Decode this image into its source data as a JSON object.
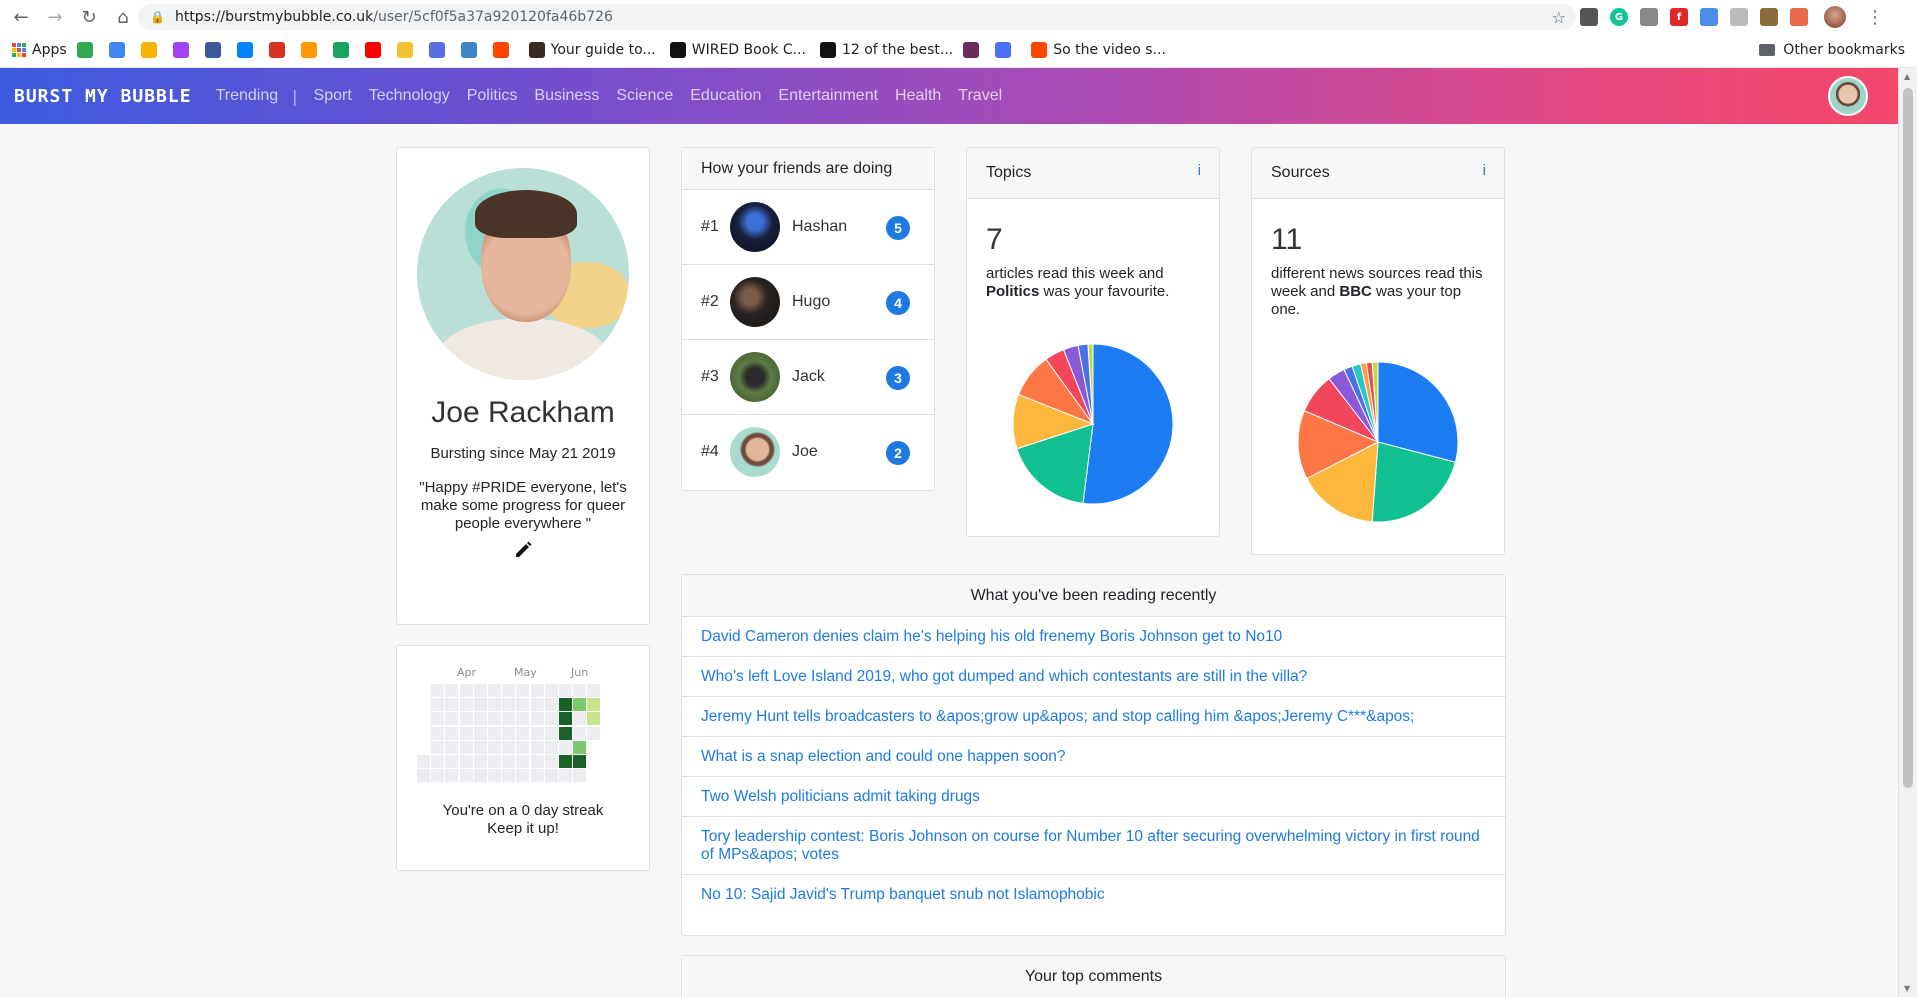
{
  "browser": {
    "url_host": "https://burstmybubble.co.uk",
    "url_path": "/user/5cf0f5a37a920120fa46b726",
    "bookmarks": [
      {
        "label": "Apps",
        "color": "#e8453c"
      },
      {
        "label": "",
        "color": "#34a853"
      },
      {
        "label": "",
        "color": "#4285f4"
      },
      {
        "label": "",
        "color": "#f4b400"
      },
      {
        "label": "",
        "color": "#a142f4"
      },
      {
        "label": "",
        "color": "#3b5998"
      },
      {
        "label": "",
        "color": "#0084ff"
      },
      {
        "label": "",
        "color": "#d93025"
      },
      {
        "label": "",
        "color": "#ff9900"
      },
      {
        "label": "",
        "color": "#1aa260"
      },
      {
        "label": "",
        "color": "#ff0000"
      },
      {
        "label": "",
        "color": "#f1c232"
      },
      {
        "label": "",
        "color": "#5b6ee1"
      },
      {
        "label": "",
        "color": "#3d85c6"
      },
      {
        "label": "",
        "color": "#ff4500"
      },
      {
        "label": "Your guide to...",
        "color": "#3a2a1f"
      },
      {
        "label": "WIRED Book C...",
        "color": "#111111"
      },
      {
        "label": "12 of the best...",
        "color": "#111111"
      },
      {
        "label": "",
        "color": "#6b2c5d"
      },
      {
        "label": "",
        "color": "#4f6df5"
      },
      {
        "label": "So the video s...",
        "color": "#ff4500"
      }
    ],
    "other_bookmarks": "Other bookmarks"
  },
  "navbar": {
    "brand": "BURST MY BUBBLE",
    "links": [
      "Trending",
      "Sport",
      "Technology",
      "Politics",
      "Business",
      "Science",
      "Education",
      "Entertainment",
      "Health",
      "Travel"
    ]
  },
  "profile": {
    "name": "Joe Rackham",
    "since": "Bursting since May 21 2019",
    "bio": "\"Happy #PRIDE everyone, let's make some progress for queer people everywhere \""
  },
  "calendar": {
    "months": [
      "Apr",
      "May",
      "Jun"
    ],
    "streak_line1": "You're on a 0 day streak",
    "streak_line2": "Keep it up!",
    "colors": {
      "empty": "#ebedf0",
      "l1": "#c6e48b",
      "l2": "#7bc96f",
      "l3": "#239a3b",
      "l4": "#196127"
    }
  },
  "friends": {
    "title": "How your friends are doing",
    "items": [
      {
        "rank": "#1",
        "name": "Hashan",
        "score": "5"
      },
      {
        "rank": "#2",
        "name": "Hugo",
        "score": "4"
      },
      {
        "rank": "#3",
        "name": "Jack",
        "score": "3"
      },
      {
        "rank": "#4",
        "name": "Joe",
        "score": "2"
      }
    ]
  },
  "topics": {
    "title": "Topics",
    "info": "i",
    "count": "7",
    "text_before": "articles read this week and ",
    "favourite": "Politics",
    "text_after": " was your favourite."
  },
  "sources": {
    "title": "Sources",
    "info": "i",
    "count": "11",
    "text_before": "different news sources read this week and ",
    "favourite": "BBC",
    "text_after": " was your top one."
  },
  "reading": {
    "title": "What you've been reading recently",
    "articles": [
      "David Cameron denies claim he’s helping his old frenemy Boris Johnson get to No10",
      "Who’s left Love Island 2019, who got dumped and which contestants are still in the villa?",
      "Jeremy Hunt tells broadcasters to &apos;grow up&apos; and stop calling him &apos;Jeremy C***&apos;",
      "What is a snap election and could one happen soon?",
      "Two Welsh politicians admit taking drugs",
      "Tory leadership contest: Boris Johnson on course for Number 10 after securing overwhelming victory in first round of MPs&apos; votes",
      "No 10: Sajid Javid's Trump banquet snub not Islamophobic"
    ]
  },
  "comments": {
    "title": "Your top comments"
  },
  "chart_data": [
    {
      "type": "pie",
      "title": "",
      "values": [
        52,
        18,
        11,
        9,
        4,
        3,
        2,
        1
      ],
      "colors": [
        "#1c7cf1",
        "#10c090",
        "#fdb73d",
        "#fd7646",
        "#f2475b",
        "#8b58d8",
        "#4a70e8",
        "#c4d84a"
      ]
    },
    {
      "type": "pie",
      "title": "",
      "values": [
        25,
        19,
        14,
        12,
        7,
        3,
        1.5,
        1.5,
        1,
        1,
        1
      ],
      "colors": [
        "#1c7cf1",
        "#10c090",
        "#fdb73d",
        "#fd7646",
        "#f2475b",
        "#8b58d8",
        "#4a70e8",
        "#2bc4c4",
        "#ff9a3d",
        "#e85050",
        "#c4d84a"
      ]
    }
  ]
}
